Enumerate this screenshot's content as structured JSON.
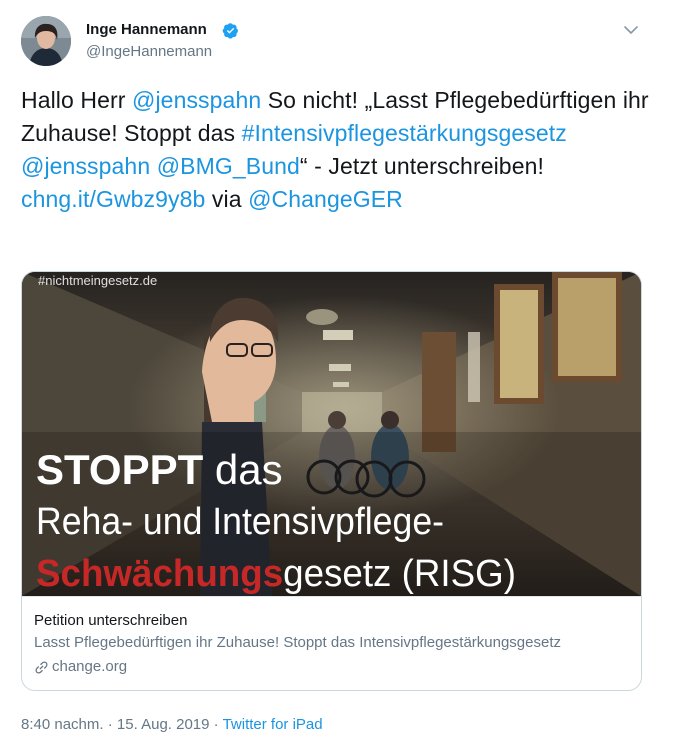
{
  "author": {
    "display_name": "Inge Hannemann",
    "handle": "@IngeHannemann"
  },
  "tweet": {
    "t1": "Hallo Herr ",
    "m1": "@jensspahn",
    "t2": " So nicht! „Lasst Pflegebedürftigen ihr Zuhause! Stoppt das ",
    "h1": "#Intensivpflegestärkungsgesetz",
    "t3": " ",
    "m2": "@jensspahn",
    "t4": " ",
    "m3": "@BMG_Bund",
    "t5": "“ - Jetzt unterschreiben! ",
    "l1": "chng.it/Gwbz9y8b",
    "t6": " via ",
    "m4": "@ChangeGER"
  },
  "card": {
    "image_watermark": "#nichtmeingesetz.de",
    "image_line1_a": "STOPPT",
    "image_line1_b": " das",
    "image_line2": "Reha- und Intensivpflege-",
    "image_line3_a": "Schwächungs",
    "image_line3_b": "gesetz (RISG)",
    "title": "Petition unterschreiben",
    "description": "Lasst Pflegebedürftigen ihr Zuhause! Stoppt das Intensivpflegestärkungsgesetz",
    "domain": "change.org"
  },
  "meta": {
    "time": "8:40 nachm.",
    "sep1": " · ",
    "date": "15. Aug. 2019",
    "sep2": " · ",
    "source": "Twitter for iPad"
  },
  "icons": {
    "verified": "verified-badge-icon",
    "caret": "chevron-down-icon",
    "link": "link-icon"
  },
  "colors": {
    "link": "#1b95e0",
    "secondary": "#657786",
    "verified": "#1da1f2",
    "image_red": "#c62828"
  }
}
